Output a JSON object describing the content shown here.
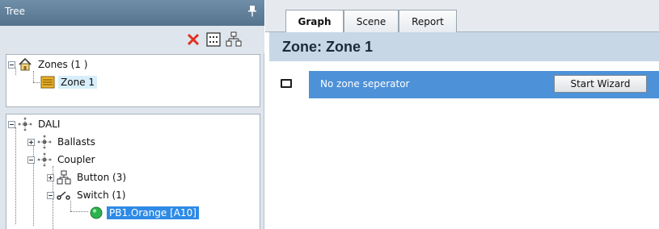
{
  "tree_pane": {
    "title": "Tree",
    "pin_icon": "pin-icon",
    "toolbar": {
      "delete_icon": "delete-icon",
      "grid_icon": "grid-icon",
      "structure_icon": "tree-structure-icon",
      "delete_color": "#e0301e"
    }
  },
  "zones_tree": {
    "root_label": "Zones (1 )",
    "root_icon": "house-icon",
    "child_label": "Zone 1",
    "child_icon": "zone-icon"
  },
  "dali_tree": {
    "root_label": "DALI",
    "ballasts_label": "Ballasts",
    "coupler_label": "Coupler",
    "button_label": "Button (3)",
    "switch_label": "Switch (1)",
    "switch_child_label": "PB1.Orange [A10]",
    "status_color": "#2bb24c",
    "selection_color": "#2d8ae6"
  },
  "tabs": [
    {
      "label": "Graph",
      "active": true
    },
    {
      "label": "Scene",
      "active": false
    },
    {
      "label": "Report",
      "active": false
    }
  ],
  "zone_header": {
    "title": "Zone: Zone 1"
  },
  "separator": {
    "text": "No zone seperator",
    "button_label": "Start Wizard",
    "row_color": "#4d91d8"
  }
}
